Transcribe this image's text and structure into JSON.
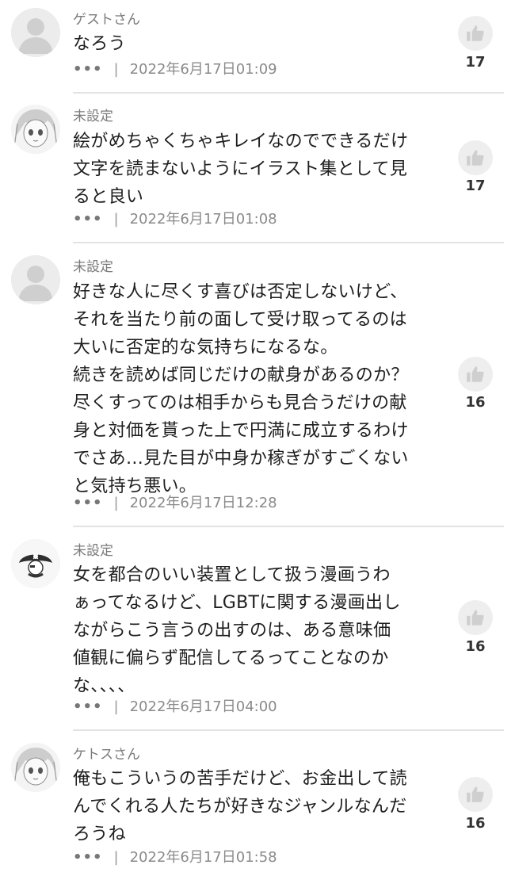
{
  "icons": {
    "avatar": "avatar-icon",
    "more": "more-dots-icon",
    "like": "thumbs-up-icon"
  },
  "colors": {
    "meta": "#8a8a8a",
    "divider": "#e3e3e3",
    "like_bg": "#eeeeee",
    "like_icon": "#c9c9c9"
  },
  "comments": [
    {
      "user": "ゲストさん",
      "text": "なろう",
      "more": "•••",
      "sep": "|",
      "time": "2022年6月17日01:09",
      "likes": "17"
    },
    {
      "user": "未設定",
      "text": "絵がめちゃくちゃキレイなのでできるだけ\n文字を読まないようにイラスト集として見\nると良い",
      "more": "•••",
      "sep": "|",
      "time": "2022年6月17日01:08",
      "likes": "17"
    },
    {
      "user": "未設定",
      "text": "好きな人に尽くす喜びは否定しないけど、\nそれを当たり前の面して受け取ってるのは\n大いに否定的な気持ちになるな。\n続きを読めば同じだけの献身があるのか？\n尽くすってのは相手からも見合うだけの献\n身と対価を貰った上で円満に成立するわけ\nでさあ…見た目が中身か稼ぎがすごくない\nと気持ち悪い。",
      "more": "•••",
      "sep": "|",
      "time": "2022年6月17日12:28",
      "likes": "16"
    },
    {
      "user": "未設定",
      "text": "女を都合のいい装置として扱う漫画うわ\nぁってなるけど、LGBTに関する漫画出し\nながらこう言うの出すのは、ある意味価\n値観に偏らず配信してるってことなのか\nな、、、、",
      "more": "•••",
      "sep": "|",
      "time": "2022年6月17日04:00",
      "likes": "16"
    },
    {
      "user": "ケトスさん",
      "text": "俺もこういうの苦手だけど、お金出して読\nんでくれる人たちが好きなジャンルなんだ\nろうね",
      "more": "•••",
      "sep": "|",
      "time": "2022年6月17日01:58",
      "likes": "16"
    }
  ]
}
